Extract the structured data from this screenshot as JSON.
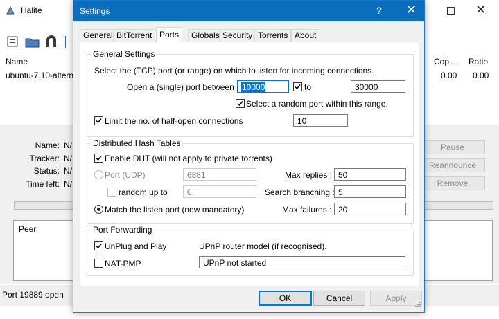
{
  "main": {
    "title": "Halite",
    "columns": [
      "Name",
      "Cop...",
      "Ratio"
    ],
    "row": {
      "name": "ubuntu-7.10-altern",
      "copies": "0.00",
      "ratio": "0.00"
    },
    "details": {
      "name_label": "Name:",
      "name_value": "N/",
      "tracker_label": "Tracker:",
      "tracker_value": "N/",
      "status_label": "Status:",
      "status_value": "N/",
      "time_label": "Time left:",
      "time_value": "N/"
    },
    "peer_header": "Peer",
    "side_buttons": [
      "Pause",
      "Reannounce",
      "Remove"
    ],
    "status_text": "Port 19889 open"
  },
  "dialog": {
    "title": "Settings",
    "help_glyph": "?",
    "close_glyph": "✕",
    "tabs": [
      "General",
      "BitTorrent",
      "Ports",
      "Globals",
      "Security",
      "Torrents",
      "About"
    ],
    "active_tab": "Ports",
    "general": {
      "title": "General Settings",
      "instruction": "Select the (TCP) port (or range) on which to listen for incoming connections.",
      "open_port_label": "Open a (single) port between :",
      "port_from": "10000",
      "to_label": "to",
      "port_to": "30000",
      "random_label": "Select a random port within this range.",
      "halfopen_label": "Limit the no. of half-open connections",
      "halfopen_value": "10"
    },
    "dht": {
      "title": "Distributed Hash Tables",
      "enable_label": "Enable DHT (will not apply to private torrents)",
      "port_udp_label": "Port (UDP)",
      "port_udp_value": "6881",
      "random_up_label": "random up to",
      "random_up_value": "0",
      "match_label": "Match the listen port (now mandatory)",
      "max_replies_label": "Max replies :",
      "max_replies_value": "50",
      "search_branching_label": "Search branching :",
      "search_branching_value": "5",
      "max_failures_label": "Max failures :",
      "max_failures_value": "20"
    },
    "forwarding": {
      "title": "Port Forwarding",
      "upnp_label": "UnPlug and Play",
      "upnp_model_label": "UPnP router model (if recognised).",
      "natpmp_label": "NAT-PMP",
      "upnp_status": "UPnP not started"
    },
    "buttons": {
      "ok": "OK",
      "cancel": "Cancel",
      "apply": "Apply"
    }
  },
  "colors": {
    "accent": "#0078d7",
    "titlebar": "#0a6ebd"
  }
}
